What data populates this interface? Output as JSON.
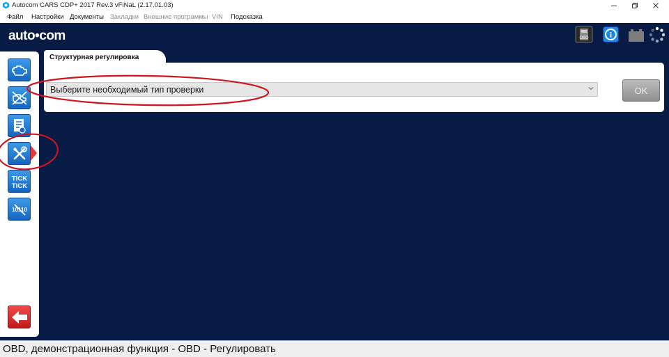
{
  "window": {
    "title": "Autocom CARS CDP+ 2017 Rev.3 vFiNaL (2.17.01.03)"
  },
  "menu": {
    "items": [
      {
        "label": "Файл",
        "enabled": true
      },
      {
        "label": "Настройки",
        "enabled": true
      },
      {
        "label": "Документы",
        "enabled": true
      },
      {
        "label": "Закладки",
        "enabled": false
      },
      {
        "label": "Внешние программы",
        "enabled": false
      },
      {
        "label": "VIN",
        "enabled": false
      },
      {
        "label": "Подсказка",
        "enabled": true
      }
    ]
  },
  "header": {
    "logo": "auto•com",
    "icons": [
      "obd-icon",
      "help-icon",
      "battery-icon",
      "loading-spinner-icon"
    ],
    "obd_label": "OBD"
  },
  "sidebar": {
    "items": [
      {
        "icon": "engine-icon"
      },
      {
        "icon": "erase-codes-icon"
      },
      {
        "icon": "checklist-icon"
      },
      {
        "icon": "wrench-screwdriver-icon",
        "active": true
      },
      {
        "icon": "tick-tick-icon",
        "label": "TICK\nTICK"
      },
      {
        "icon": "odometer-icon",
        "label": "10110"
      }
    ],
    "back_icon": "back-arrow-icon"
  },
  "content": {
    "tab_label": "Структурная регулировка",
    "select": {
      "value": "Выберите необходимый тип проверки"
    },
    "ok_label": "OK"
  },
  "status": {
    "text": "OBD, демонстрационная функция - OBD - Регулировать"
  },
  "colors": {
    "background": "#071b45",
    "button_blue": "#1e7fd8",
    "back_button_red": "#d32020",
    "annotation_red": "#d0141d"
  }
}
